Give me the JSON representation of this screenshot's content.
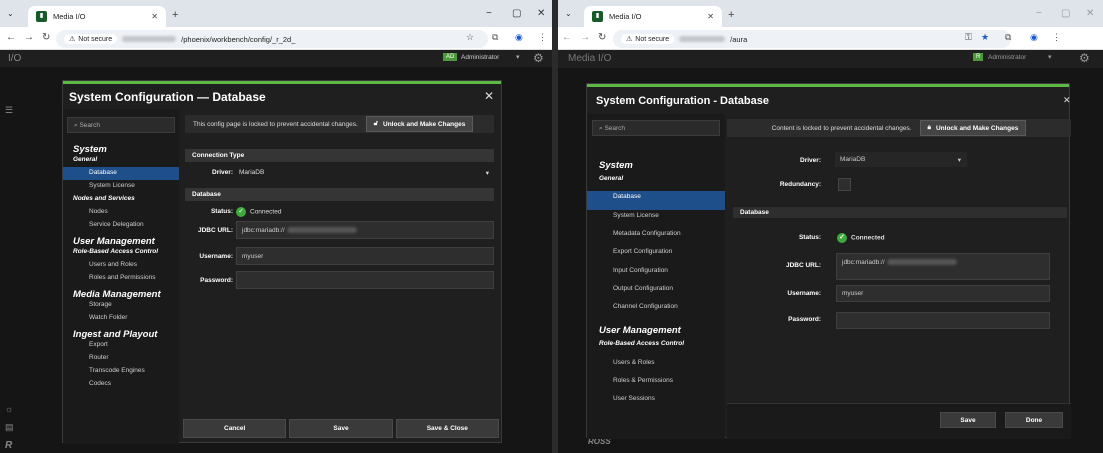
{
  "left": {
    "tab_title": "Media I/O",
    "url_tail": "/phoenix/workbench/config/_r_2d_",
    "not_secure": "Not secure",
    "app_label": "I/O",
    "user_badge": "AD",
    "user_name": "Administrator",
    "modal_title": "System Configuration — Database",
    "search_placeholder": "Search",
    "lock_message": "This config page is locked to prevent accidental changes.",
    "unlock_label": "Unlock and Make Changes",
    "nav": [
      {
        "label": "System",
        "level": "h1"
      },
      {
        "label": "General",
        "level": "h2"
      },
      {
        "label": "Database",
        "level": "item",
        "selected": true
      },
      {
        "label": "System License",
        "level": "item"
      },
      {
        "label": "Nodes and Services",
        "level": "h2"
      },
      {
        "label": "Nodes",
        "level": "item"
      },
      {
        "label": "Service Delegation",
        "level": "item"
      },
      {
        "label": "User Management",
        "level": "h1"
      },
      {
        "label": "Role-Based Access Control",
        "level": "h2"
      },
      {
        "label": "Users and Roles",
        "level": "item"
      },
      {
        "label": "Roles and Permissions",
        "level": "item"
      },
      {
        "label": "Media Management",
        "level": "h1"
      },
      {
        "label": "Storage",
        "level": "item"
      },
      {
        "label": "Watch Folder",
        "level": "item"
      },
      {
        "label": "Ingest and Playout",
        "level": "h1"
      },
      {
        "label": "Export",
        "level": "item"
      },
      {
        "label": "Router",
        "level": "item"
      },
      {
        "label": "Transcode Engines",
        "level": "item"
      },
      {
        "label": "Codecs",
        "level": "item"
      }
    ],
    "section_connection": "Connection Type",
    "driver_label": "Driver:",
    "driver_value": "MariaDB",
    "section_database": "Database",
    "status_label": "Status:",
    "status_value": "Connected",
    "jdbc_label": "JDBC URL:",
    "jdbc_prefix": "jdbc:mariadb://",
    "username_label": "Username:",
    "username_value": "myuser",
    "password_label": "Password:",
    "footer": [
      "Cancel",
      "Save",
      "Save & Close"
    ]
  },
  "right": {
    "tab_title": "Media I/O",
    "url_tail": "/aura",
    "not_secure": "Not secure",
    "app_label": "Media I/O",
    "user_badge": "R",
    "user_name": "Administrator",
    "modal_title": "System Configuration - Database",
    "search_placeholder": "Search",
    "lock_message": "Content is locked to prevent accidental changes.",
    "unlock_label": "Unlock and Make Changes",
    "nav": [
      {
        "label": "System",
        "level": "h1"
      },
      {
        "label": "General",
        "level": "h2"
      },
      {
        "label": "Database",
        "level": "item",
        "selected": true
      },
      {
        "label": "System License",
        "level": "item"
      },
      {
        "label": "Metadata Configuration",
        "level": "item"
      },
      {
        "label": "Export Configuration",
        "level": "item"
      },
      {
        "label": "Input Configuration",
        "level": "item"
      },
      {
        "label": "Output Configuration",
        "level": "item"
      },
      {
        "label": "Channel Configuration",
        "level": "item"
      },
      {
        "label": "User Management",
        "level": "h1"
      },
      {
        "label": "Role-Based Access Control",
        "level": "h2"
      },
      {
        "label": "Users & Roles",
        "level": "item"
      },
      {
        "label": "Roles & Permissions",
        "level": "item"
      },
      {
        "label": "User Sessions",
        "level": "item"
      }
    ],
    "driver_label": "Driver:",
    "driver_value": "MariaDB",
    "redundancy_label": "Redundancy:",
    "section_database": "Database",
    "status_label": "Status:",
    "status_value": "Connected",
    "jdbc_label": "JDBC URL:",
    "jdbc_prefix": "jdbc:mariadb://",
    "username_label": "Username:",
    "username_value": "myuser",
    "password_label": "Password:",
    "footer": [
      "Save",
      "Done"
    ],
    "brand": "ROSS"
  },
  "colors": {
    "accent_green": "#5cb946",
    "selection_blue": "#1f4f8a",
    "status_green": "#3caa3c"
  }
}
